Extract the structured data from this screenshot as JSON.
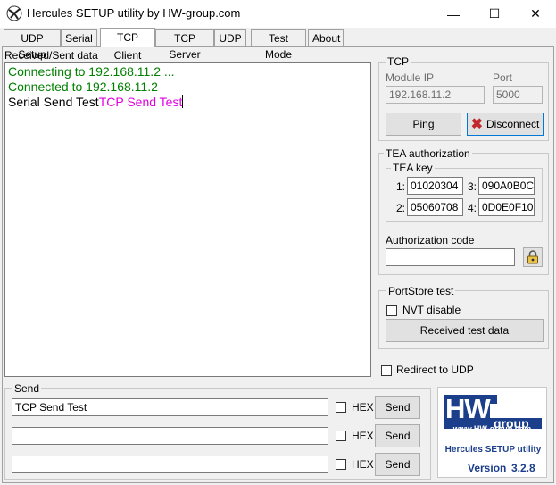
{
  "window": {
    "title": "Hercules SETUP utility by HW-group.com",
    "minimize_glyph": "—",
    "maximize_glyph": "☐",
    "close_glyph": "✕"
  },
  "tabs": [
    {
      "label": "UDP Setup"
    },
    {
      "label": "Serial"
    },
    {
      "label": "TCP Client",
      "active": true
    },
    {
      "label": "TCP Server"
    },
    {
      "label": "UDP"
    },
    {
      "label": "Test Mode"
    },
    {
      "label": "About"
    }
  ],
  "received": {
    "label": "Received/Sent data",
    "lines": [
      {
        "text": "Connecting to 192.168.11.2 ...",
        "color": "#008000"
      },
      {
        "text": "Connected to 192.168.11.2",
        "color": "#008000"
      },
      {
        "text_black": "Serial Send Test",
        "text_magenta": "TCP Send Test",
        "color_magenta": "#e000e0"
      }
    ]
  },
  "tcp": {
    "group_label": "TCP",
    "module_ip_label": "Module IP",
    "module_ip_value": "192.168.11.2",
    "port_label": "Port",
    "port_value": "5000",
    "ping_label": "Ping",
    "disconnect_label": "Disconnect"
  },
  "tea": {
    "group_label": "TEA authorization",
    "key_label": "TEA key",
    "k1_label": "1:",
    "k1_value": "01020304",
    "k2_label": "2:",
    "k2_value": "05060708",
    "k3_label": "3:",
    "k3_value": "090A0B0C",
    "k4_label": "4:",
    "k4_value": "0D0E0F10",
    "auth_code_label": "Authorization code",
    "auth_code_value": ""
  },
  "portstore": {
    "group_label": "PortStore test",
    "nvt_label": "NVT disable",
    "nvt_checked": false,
    "received_test_label": "Received test data"
  },
  "redirect": {
    "label": "Redirect to UDP",
    "checked": false
  },
  "send": {
    "group_label": "Send",
    "rows": [
      {
        "value": "TCP Send Test",
        "hex_label": "HEX",
        "send_label": "Send"
      },
      {
        "value": "",
        "hex_label": "HEX",
        "send_label": "Send"
      },
      {
        "value": "",
        "hex_label": "HEX",
        "send_label": "Send"
      }
    ]
  },
  "logo": {
    "brand_hw": "HW",
    "brand_group": "group",
    "url": "www.HW-group.com",
    "product": "Hercules SETUP utility",
    "version_label": "Version",
    "version_value": "3.2.8",
    "accent_color": "#1c3f8c"
  }
}
